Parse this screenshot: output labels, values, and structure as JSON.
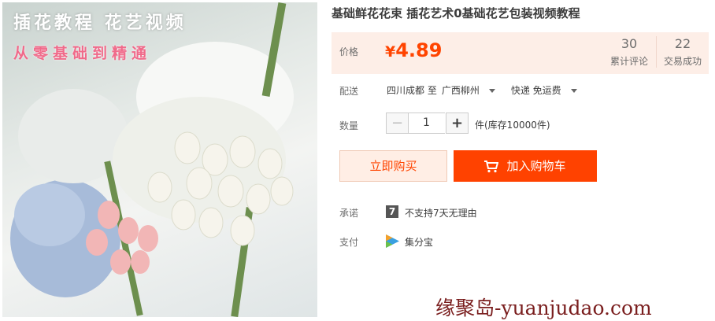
{
  "banner": {
    "line1": "插花教程 花艺视频",
    "line2": "从零基础到精通"
  },
  "product": {
    "title": "基础鲜花花束 插花艺术0基础花艺包装视频教程"
  },
  "price": {
    "label": "价格",
    "currency": "¥",
    "value": "4.89",
    "reviews_count": "30",
    "reviews_label": "累计评论",
    "deals_count": "22",
    "deals_label": "交易成功"
  },
  "delivery": {
    "label": "配送",
    "from": "四川成都 至",
    "to": "广西柳州",
    "method": "快递 免运费"
  },
  "quantity": {
    "label": "数量",
    "minus": "−",
    "value": "1",
    "plus": "+",
    "stock": "件(库存10000件)"
  },
  "actions": {
    "buy_now": "立即购买",
    "add_to_cart": "加入购物车"
  },
  "promise": {
    "label": "承诺",
    "icon_text": "7",
    "text": "不支持7天无理由"
  },
  "payment": {
    "label": "支付",
    "method": "集分宝"
  },
  "watermark": "缘聚岛-yuanjudao.com",
  "colors": {
    "accent": "#ff4400",
    "price_bg": "#fdeee7",
    "cart_button": "#ff4200",
    "buy_now_bg": "#ffeee5"
  },
  "icons": {
    "cart": "shopping-cart-icon",
    "promise": "seven-days-icon",
    "payment": "jifenbao-icon"
  }
}
